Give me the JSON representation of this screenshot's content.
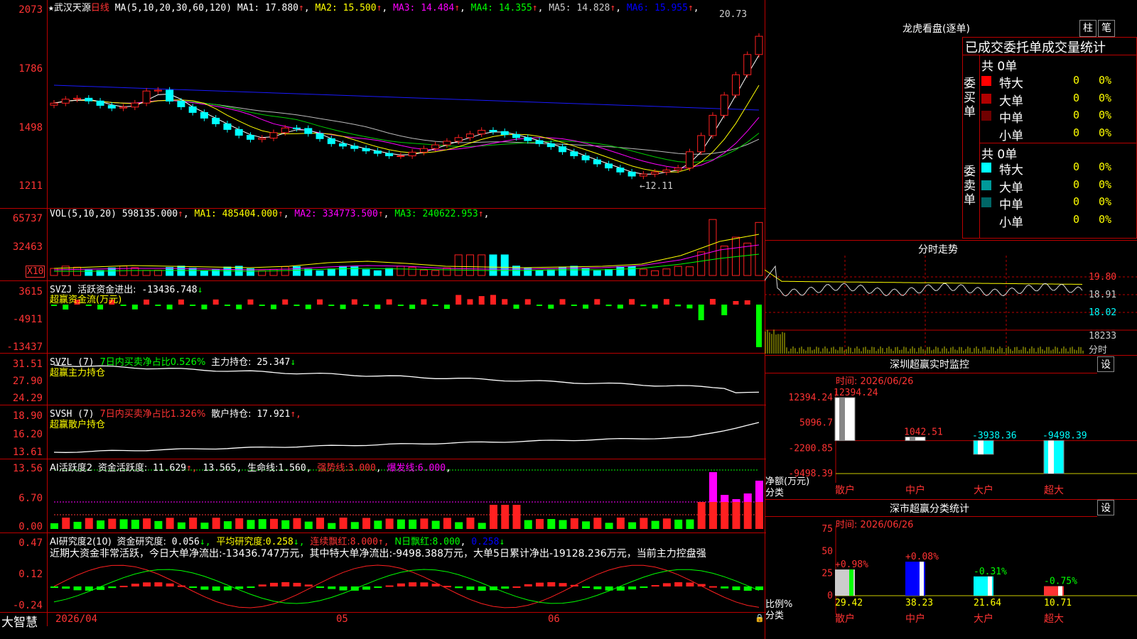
{
  "stock": {
    "name": "武汉天源",
    "period": "日线",
    "ma_label": "MA(5,10,20,30,60,120)",
    "ma_values": [
      {
        "label": "MA1:",
        "value": "17.880",
        "arrow": "↑",
        "color": "#ffffff"
      },
      {
        "label": "MA2:",
        "value": "15.500",
        "arrow": "↑",
        "color": "#ffff00"
      },
      {
        "label": "MA3:",
        "value": "14.484",
        "arrow": "↑",
        "color": "#ff00ff"
      },
      {
        "label": "MA4:",
        "value": "14.355",
        "arrow": "↑",
        "color": "#00ff00"
      },
      {
        "label": "MA5:",
        "value": "14.828",
        "arrow": "↑",
        "color": "#cccccc"
      },
      {
        "label": "MA6:",
        "value": "15.955",
        "arrow": "↑",
        "color": "#0000ff"
      }
    ],
    "high_marker": "20.73",
    "low_marker": "←12.11",
    "y_ticks": [
      "2073",
      "1786",
      "1498",
      "1211"
    ]
  },
  "vol": {
    "header": "VOL(5,10,20)",
    "value": "598135.000",
    "ma": [
      {
        "label": "MA1:",
        "value": "485404.000",
        "arrow": "↑",
        "color": "#ffff00"
      },
      {
        "label": "MA2:",
        "value": "334773.500",
        "arrow": "↑",
        "color": "#ff00ff"
      },
      {
        "label": "MA3:",
        "value": "240622.953",
        "arrow": "↑",
        "color": "#00ff00"
      }
    ],
    "y_ticks": [
      "65737",
      "32463"
    ],
    "unit": "X10"
  },
  "svzj": {
    "header": "SVZJ",
    "label": "活跃资金进出:",
    "value": "-13436.748",
    "arrow": "↓",
    "sub": "超赢资金流(万元)",
    "y_ticks": [
      "3615",
      "-4911",
      "-13437"
    ]
  },
  "svzl": {
    "header": "SVZL (7)",
    "ratio_text": "7日内买卖净占比0.526%",
    "label": "主力持仓:",
    "value": "25.347",
    "arrow": "↓",
    "sub": "超赢主力持仓",
    "y_ticks": [
      "31.51",
      "27.90",
      "24.29"
    ]
  },
  "svsh": {
    "header": "SVSH (7)",
    "ratio_text": "7日内买卖净占比1.326%",
    "label": "散户持仓:",
    "value": "17.921",
    "arrow": "↑,",
    "sub": "超赢散户持仓",
    "y_ticks": [
      "18.90",
      "16.20",
      "13.61"
    ]
  },
  "ai_active": {
    "header": "AI活跃度2",
    "label": "资金活跃度:",
    "v1": "11.629",
    "a1": "↑,",
    "v2": "13.565",
    "a2": ",",
    "life_label": "生命线:",
    "life": "1.560",
    "strong_label": "强势线:",
    "strong": "3.000",
    "burst_label": "爆发线:",
    "burst": "6.000",
    "y_ticks": [
      "13.56",
      "6.70",
      "0.00"
    ]
  },
  "ai_research": {
    "header": "AI研究度2(10)",
    "label": "资金研究度:",
    "v1": "0.056",
    "a1": "↓,",
    "avg_label": "平均研究度:",
    "avg": "0.258",
    "a2": "↓,",
    "streak_label": "连续飘红:",
    "streak": "8.000",
    "a3": "↑,",
    "n_label": "N日飘红:",
    "n": "8.000",
    "extra": "0.258",
    "a4": "↓",
    "note": "近期大资金非常活跃，今日大单净流出:-13436.747万元，其中特大单净流出:-9498.388万元，大单5日累计净出-19128.236万元，当前主力控盘强",
    "y_ticks": [
      "0.47",
      "0.12",
      "-0.24"
    ]
  },
  "bottom": {
    "brand": "大智慧",
    "dates": [
      "2026/04",
      "05",
      "06"
    ]
  },
  "dragon": {
    "title": "龙虎看盘(逐单)",
    "btn_bar": "柱",
    "btn_pen": "笔",
    "header": "已成交委托单成交量统计",
    "buy_label": "委买单",
    "sell_label": "委卖单",
    "buy_total": "共 0单",
    "sell_total": "共 0单",
    "buy_rows": [
      {
        "name": "特大",
        "count": "0",
        "pct": "0%",
        "color": "#ff0000"
      },
      {
        "name": "大单",
        "count": "0",
        "pct": "0%",
        "color": "#b00000"
      },
      {
        "name": "中单",
        "count": "0",
        "pct": "0%",
        "color": "#700000"
      },
      {
        "name": "小单",
        "count": "0",
        "pct": "0%",
        "color": "#000000"
      }
    ],
    "sell_rows": [
      {
        "name": "特大",
        "count": "0",
        "pct": "0%",
        "color": "#00ffff"
      },
      {
        "name": "大单",
        "count": "0",
        "pct": "0%",
        "color": "#009999"
      },
      {
        "name": "中单",
        "count": "0",
        "pct": "0%",
        "color": "#006666"
      },
      {
        "name": "小单",
        "count": "0",
        "pct": "0%",
        "color": "#000000"
      }
    ]
  },
  "intraday": {
    "title": "分时走势",
    "y_ticks": [
      "19.80",
      "18.91",
      "18.02",
      "18233"
    ],
    "unit": "分时"
  },
  "sz_monitor": {
    "title": "深圳超赢实时监控",
    "btn": "设",
    "time": "时间: 2026/06/26",
    "axis_label": "净额(万元)",
    "cat_label": "分类",
    "y_ticks": [
      "12394.24",
      "5096.7",
      "-2200.85",
      "-9498.39"
    ]
  },
  "sz_class": {
    "title": "深市超赢分类统计",
    "btn": "设",
    "time": "时间: 2026/06/26",
    "axis_label": "比例%",
    "cat_label": "分类",
    "y_ticks": [
      "75",
      "50",
      "25",
      "0"
    ]
  },
  "chart_data": [
    {
      "type": "bar",
      "title": "深圳超赢实时监控",
      "ylabel": "净额(万元)",
      "xlabel": "分类",
      "categories": [
        "散户",
        "中户",
        "大户",
        "超大"
      ],
      "values": [
        12394.24,
        1042.51,
        -3938.36,
        -9498.39
      ],
      "labels": [
        "12394.24",
        "1042.51",
        "-3938.36",
        "-9498.39"
      ],
      "ylim": [
        -9498.39,
        12394.24
      ]
    },
    {
      "type": "bar",
      "title": "深市超赢分类统计",
      "ylabel": "比例%",
      "xlabel": "分类",
      "categories": [
        "散户",
        "中户",
        "大户",
        "超大"
      ],
      "values": [
        29.42,
        38.23,
        21.64,
        10.71
      ],
      "labels": [
        "29.42",
        "38.23",
        "21.64",
        "10.71"
      ],
      "changes": [
        "+0.98%",
        "+0.08%",
        "-0.31%",
        "-0.75%"
      ],
      "ylim": [
        0,
        75
      ]
    }
  ]
}
